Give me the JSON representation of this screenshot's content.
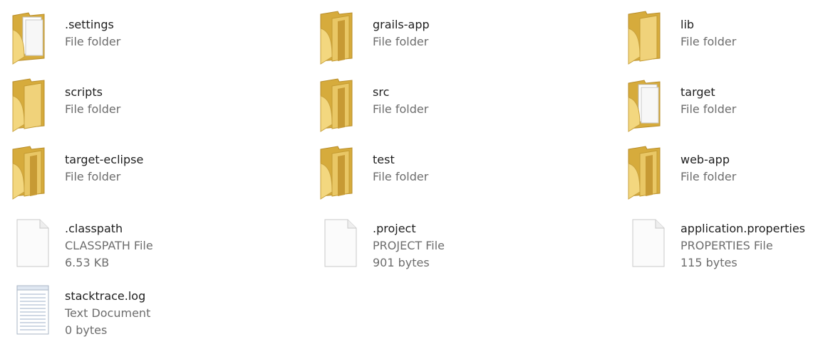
{
  "items": [
    {
      "name": ".settings",
      "type": "File folder",
      "icon": "folder-with-papers-icon"
    },
    {
      "name": "grails-app",
      "type": "File folder",
      "icon": "folder-icon"
    },
    {
      "name": "lib",
      "type": "File folder",
      "icon": "folder-icon"
    },
    {
      "name": "scripts",
      "type": "File folder",
      "icon": "folder-icon"
    },
    {
      "name": "src",
      "type": "File folder",
      "icon": "folder-icon"
    },
    {
      "name": "target",
      "type": "File folder",
      "icon": "folder-with-papers-icon"
    },
    {
      "name": "target-eclipse",
      "type": "File folder",
      "icon": "folder-icon"
    },
    {
      "name": "test",
      "type": "File folder",
      "icon": "folder-icon"
    },
    {
      "name": "web-app",
      "type": "File folder",
      "icon": "folder-icon"
    },
    {
      "name": ".classpath",
      "type": "CLASSPATH File",
      "size": "6.53 KB",
      "icon": "file-icon"
    },
    {
      "name": ".project",
      "type": "PROJECT File",
      "size": "901 bytes",
      "icon": "file-icon"
    },
    {
      "name": "application.properties",
      "type": "PROPERTIES File",
      "size": "115 bytes",
      "icon": "file-icon"
    },
    {
      "name": "stacktrace.log",
      "type": "Text Document",
      "size": "0 bytes",
      "icon": "text-document-icon"
    }
  ],
  "colors": {
    "folder_front": "#f2d67c",
    "folder_back": "#dcb44a",
    "file_border": "#c9c9c9",
    "text_primary": "#1e1e1e",
    "text_secondary": "#6d6d6d"
  }
}
